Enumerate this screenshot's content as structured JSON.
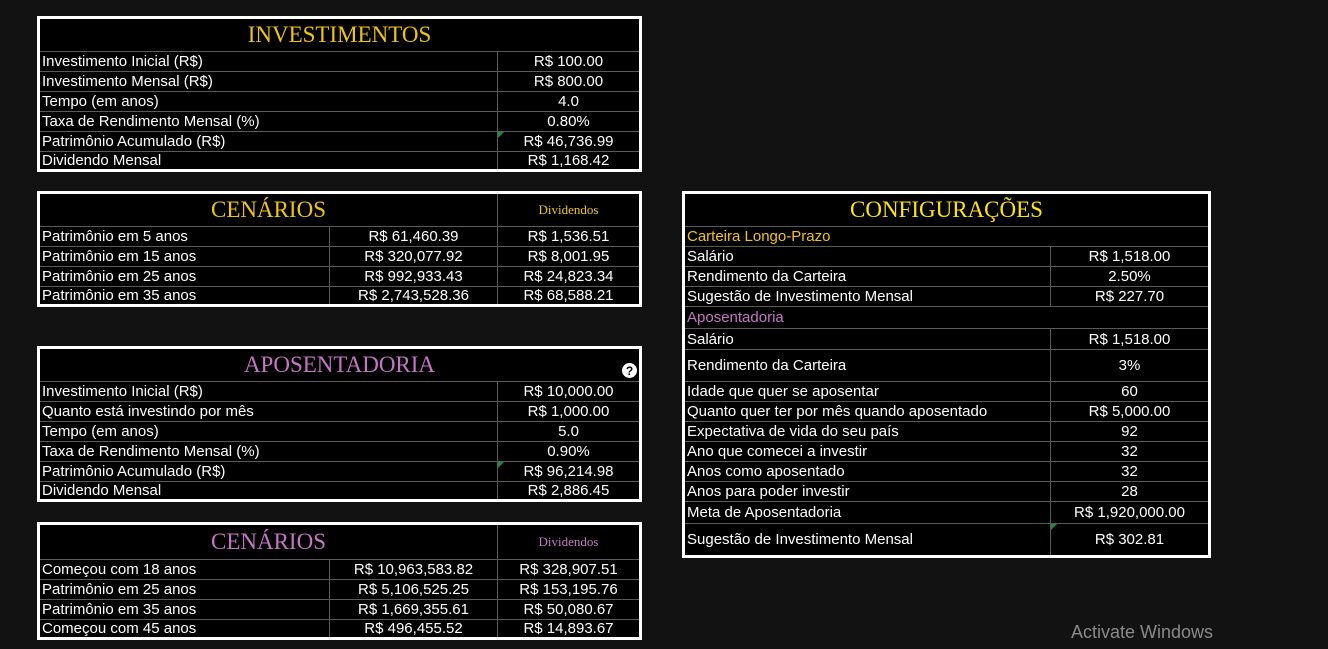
{
  "colors": {
    "gold": "#f1c40f",
    "pink": "#c774c7",
    "background": "#121212",
    "panel": "#000000",
    "border": "#ffffff"
  },
  "investimentos": {
    "title": "INVESTIMENTOS",
    "rows": [
      {
        "label": "Investimento Inicial (R$)",
        "value": "R$ 100.00"
      },
      {
        "label": "Investimento Mensal (R$)",
        "value": "R$ 800.00"
      },
      {
        "label": "Tempo (em anos)",
        "value": "4.0"
      },
      {
        "label": "Taxa de Rendimento Mensal (%)",
        "value": "0.80%"
      },
      {
        "label": "Patrimônio Acumulado (R$)",
        "value": "R$ 46,736.99"
      },
      {
        "label": "Dividendo Mensal",
        "value": "R$ 1,168.42"
      }
    ]
  },
  "cenarios1": {
    "title": "CENÁRIOS",
    "dividends_header": "Dividendos",
    "rows": [
      {
        "label": "Patrimônio em 5 anos",
        "value": "R$ 61,460.39",
        "dividend": "R$ 1,536.51"
      },
      {
        "label": "Patrimônio em 15 anos",
        "value": "R$ 320,077.92",
        "dividend": "R$ 8,001.95"
      },
      {
        "label": "Patrimônio em 25 anos",
        "value": "R$ 992,933.43",
        "dividend": "R$ 24,823.34"
      },
      {
        "label": "Patrimônio em 35 anos",
        "value": "R$ 2,743,528.36",
        "dividend": "R$ 68,588.21"
      }
    ]
  },
  "aposentadoria": {
    "title": "APOSENTADORIA",
    "help_icon": "?",
    "rows": [
      {
        "label": "Investimento Inicial (R$)",
        "value": "R$ 10,000.00"
      },
      {
        "label": "Quanto está investindo por mês",
        "value": "R$ 1,000.00"
      },
      {
        "label": "Tempo (em anos)",
        "value": "5.0"
      },
      {
        "label": "Taxa de Rendimento Mensal (%)",
        "value": "0.90%"
      },
      {
        "label": "Patrimônio Acumulado (R$)",
        "value": "R$ 96,214.98"
      },
      {
        "label": "Dividendo Mensal",
        "value": "R$ 2,886.45"
      }
    ]
  },
  "cenarios2": {
    "title": "CENÁRIOS",
    "dividends_header": "Dividendos",
    "rows": [
      {
        "label": "Começou com 18 anos",
        "value": "R$ 10,963,583.82",
        "dividend": "R$ 328,907.51"
      },
      {
        "label": "Patrimônio em 25 anos",
        "value": "R$ 5,106,525.25",
        "dividend": "R$ 153,195.76"
      },
      {
        "label": "Patrimônio em 35 anos",
        "value": "R$ 1,669,355.61",
        "dividend": "R$ 50,080.67"
      },
      {
        "label": "Começou com 45 anos",
        "value": "R$ 496,455.52",
        "dividend": "R$ 14,893.67"
      }
    ]
  },
  "configuracoes": {
    "title": "CONFIGURAÇÕES",
    "carteira": {
      "heading": "Carteira Longo-Prazo",
      "rows": [
        {
          "label": "Salário",
          "value": "R$ 1,518.00"
        },
        {
          "label": "Rendimento da Carteira",
          "value": "2.50%"
        },
        {
          "label": "Sugestão de Investimento Mensal",
          "value": "R$ 227.70"
        }
      ]
    },
    "aposentadoria": {
      "heading": "Aposentadoria",
      "rows": [
        {
          "label": "Salário",
          "value": "R$ 1,518.00"
        },
        {
          "label": "Rendimento da Carteira",
          "value": "3%"
        },
        {
          "label": "Idade que quer se aposentar",
          "value": "60"
        },
        {
          "label": "Quanto quer ter por mês quando aposentado",
          "value": "R$ 5,000.00"
        },
        {
          "label": "Expectativa de vida do seu país",
          "value": "92"
        },
        {
          "label": "Ano que comecei a investir",
          "value": "32"
        },
        {
          "label": "Anos como aposentado",
          "value": "32"
        },
        {
          "label": "Anos para poder investir",
          "value": "28"
        },
        {
          "label": "Meta de Aposentadoria",
          "value": "R$ 1,920,000.00"
        },
        {
          "label": "Sugestão de Investimento Mensal",
          "value": "R$ 302.81"
        }
      ]
    }
  },
  "watermark": "Activate Windows"
}
